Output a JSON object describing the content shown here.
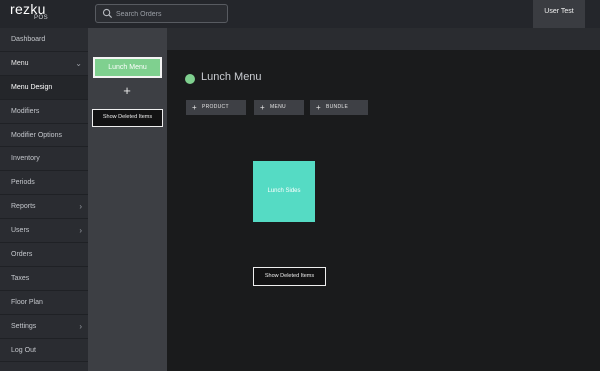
{
  "app": {
    "logo_name": "rezku",
    "logo_sub": "POS"
  },
  "search": {
    "placeholder": "Search Orders"
  },
  "user": {
    "name": "User Test"
  },
  "sidebar": {
    "items": [
      {
        "label": "Dashboard"
      },
      {
        "label": "Menu"
      },
      {
        "label": "Menu Design"
      },
      {
        "label": "Modifiers"
      },
      {
        "label": "Modifier Options"
      },
      {
        "label": "Inventory"
      },
      {
        "label": "Periods"
      },
      {
        "label": "Reports"
      },
      {
        "label": "Users"
      },
      {
        "label": "Orders"
      },
      {
        "label": "Taxes"
      },
      {
        "label": "Floor Plan"
      },
      {
        "label": "Settings"
      },
      {
        "label": "Log Out"
      }
    ]
  },
  "menus": {
    "selected_label": "Lunch Menu",
    "add_symbol": "+",
    "show_deleted_label": "Show Deleted Items"
  },
  "main": {
    "title": "Lunch Menu",
    "title_dot_color": "#7fd08f",
    "add_buttons": [
      {
        "label": "PRODUCT"
      },
      {
        "label": "MENU"
      },
      {
        "label": "BUNDLE"
      }
    ],
    "add_symbol": "+",
    "tiles": [
      {
        "label": "Lunch Sides",
        "color": "#55dbc4"
      }
    ],
    "show_deleted_label": "Show Deleted Items"
  }
}
